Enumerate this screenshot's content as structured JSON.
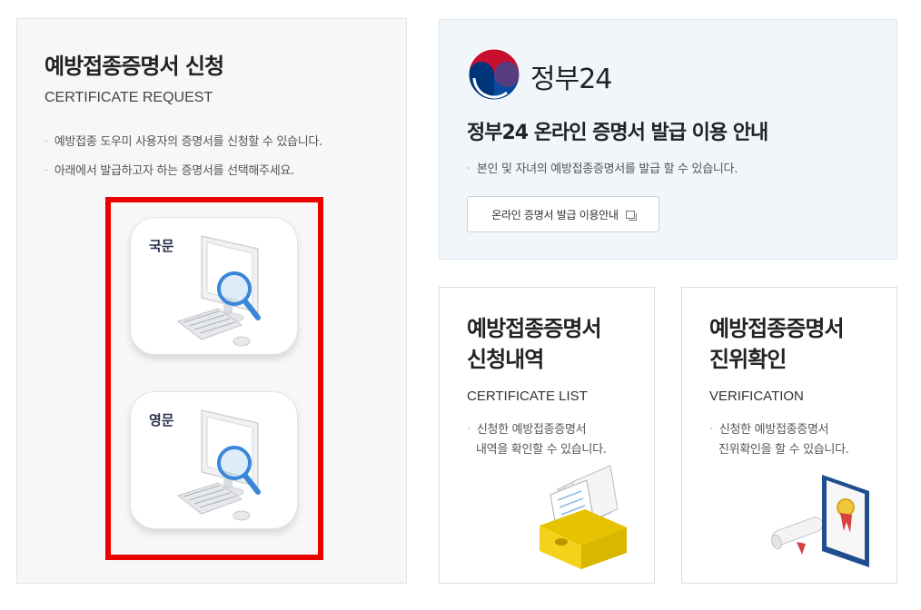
{
  "request_panel": {
    "title": "예방접종증명서 신청",
    "subtitle": "CERTIFICATE REQUEST",
    "bullets": [
      "예방접종 도우미 사용자의 증명서를 신청할 수 있습니다.",
      "아래에서 발급하고자 하는 증명서를 선택해주세요."
    ],
    "korean_button_label": "국문",
    "english_button_label": "영문"
  },
  "gov24_panel": {
    "logo_text": "정부24",
    "title": "정부24 온라인 증명서 발급 이용 안내",
    "description": "본인 및 자녀의 예방접종증명서를 발급 할 수 있습니다.",
    "guide_button_label": "온라인 증명서 발급 이용안내"
  },
  "list_card": {
    "title_line1": "예방접종증명서",
    "title_line2": "신청내역",
    "subtitle": "CERTIFICATE LIST",
    "desc_line1": "신청한 예방접종증명서",
    "desc_line2": "내역을 확인할 수 있습니다."
  },
  "verify_card": {
    "title_line1": "예방접종증명서",
    "title_line2": "진위확인",
    "subtitle": "VERIFICATION",
    "desc_line1": "신청한 예방접종증명서",
    "desc_line2": "진위확인을 할 수 있습니다."
  },
  "colors": {
    "highlight_frame": "#ee0000",
    "gov24_background": "#f1f6fb",
    "gov_logo_red": "#c8102e",
    "gov_logo_blue": "#003478"
  }
}
